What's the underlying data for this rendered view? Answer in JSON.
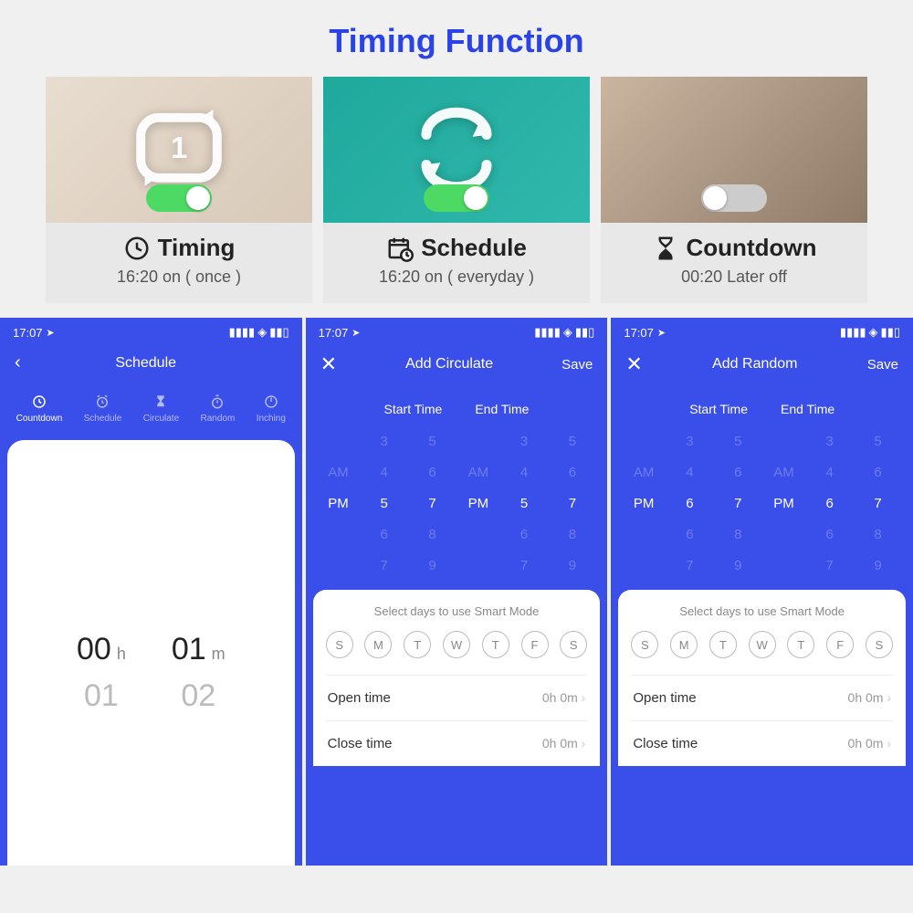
{
  "page_title": "Timing Function",
  "cards": [
    {
      "label": "Timing",
      "desc": "16:20 on ( once )",
      "toggle": true
    },
    {
      "label": "Schedule",
      "desc": "16:20 on ( everyday )",
      "toggle": true
    },
    {
      "label": "Countdown",
      "desc": "00:20 Later off",
      "toggle": false
    }
  ],
  "phones": {
    "status_time": "17:07",
    "schedule": {
      "title": "Schedule",
      "tabs": [
        "Countdown",
        "Schedule",
        "Circulate",
        "Random",
        "Inching"
      ],
      "active_tab": 0,
      "hm": {
        "h_cur": "00",
        "h_next": "01",
        "m_cur": "01",
        "m_next": "02",
        "h_unit": "h",
        "m_unit": "m"
      }
    },
    "circulate": {
      "title": "Add Circulate",
      "save": "Save",
      "start_label": "Start Time",
      "end_label": "End Time",
      "rows": {
        "r0": {
          "ampm": "",
          "a": "3",
          "b": "5",
          "c": "",
          "d": "3",
          "e": "5"
        },
        "r1": {
          "ampm": "AM",
          "a": "4",
          "b": "6",
          "c": "AM",
          "d": "4",
          "e": "6"
        },
        "r2": {
          "ampm": "PM",
          "a": "5",
          "b": "7",
          "c": "PM",
          "d": "5",
          "e": "7"
        },
        "r3": {
          "ampm": "",
          "a": "6",
          "b": "8",
          "c": "",
          "d": "6",
          "e": "8"
        },
        "r4": {
          "ampm": "",
          "a": "7",
          "b": "9",
          "c": "",
          "d": "7",
          "e": "9"
        }
      },
      "smart_label": "Select days to use Smart Mode",
      "days": [
        "S",
        "M",
        "T",
        "W",
        "T",
        "F",
        "S"
      ],
      "open_label": "Open time",
      "open_val": "0h 0m",
      "close_label": "Close time",
      "close_val": "0h 0m"
    },
    "random": {
      "title": "Add Random",
      "save": "Save",
      "start_label": "Start Time",
      "end_label": "End Time",
      "rows": {
        "r0": {
          "ampm": "",
          "a": "3",
          "b": "5",
          "c": "",
          "d": "3",
          "e": "5"
        },
        "r1": {
          "ampm": "AM",
          "a": "4",
          "b": "6",
          "c": "AM",
          "d": "4",
          "e": "6"
        },
        "r2": {
          "ampm": "PM",
          "a": "6",
          "b": "7",
          "c": "PM",
          "d": "6",
          "e": "7"
        },
        "r3": {
          "ampm": "",
          "a": "6",
          "b": "8",
          "c": "",
          "d": "6",
          "e": "8"
        },
        "r4": {
          "ampm": "",
          "a": "7",
          "b": "9",
          "c": "",
          "d": "7",
          "e": "9"
        }
      },
      "smart_label": "Select days to use Smart Mode",
      "days": [
        "S",
        "M",
        "T",
        "W",
        "T",
        "F",
        "S"
      ],
      "open_label": "Open time",
      "open_val": "0h 0m",
      "close_label": "Close time",
      "close_val": "0h 0m"
    }
  }
}
